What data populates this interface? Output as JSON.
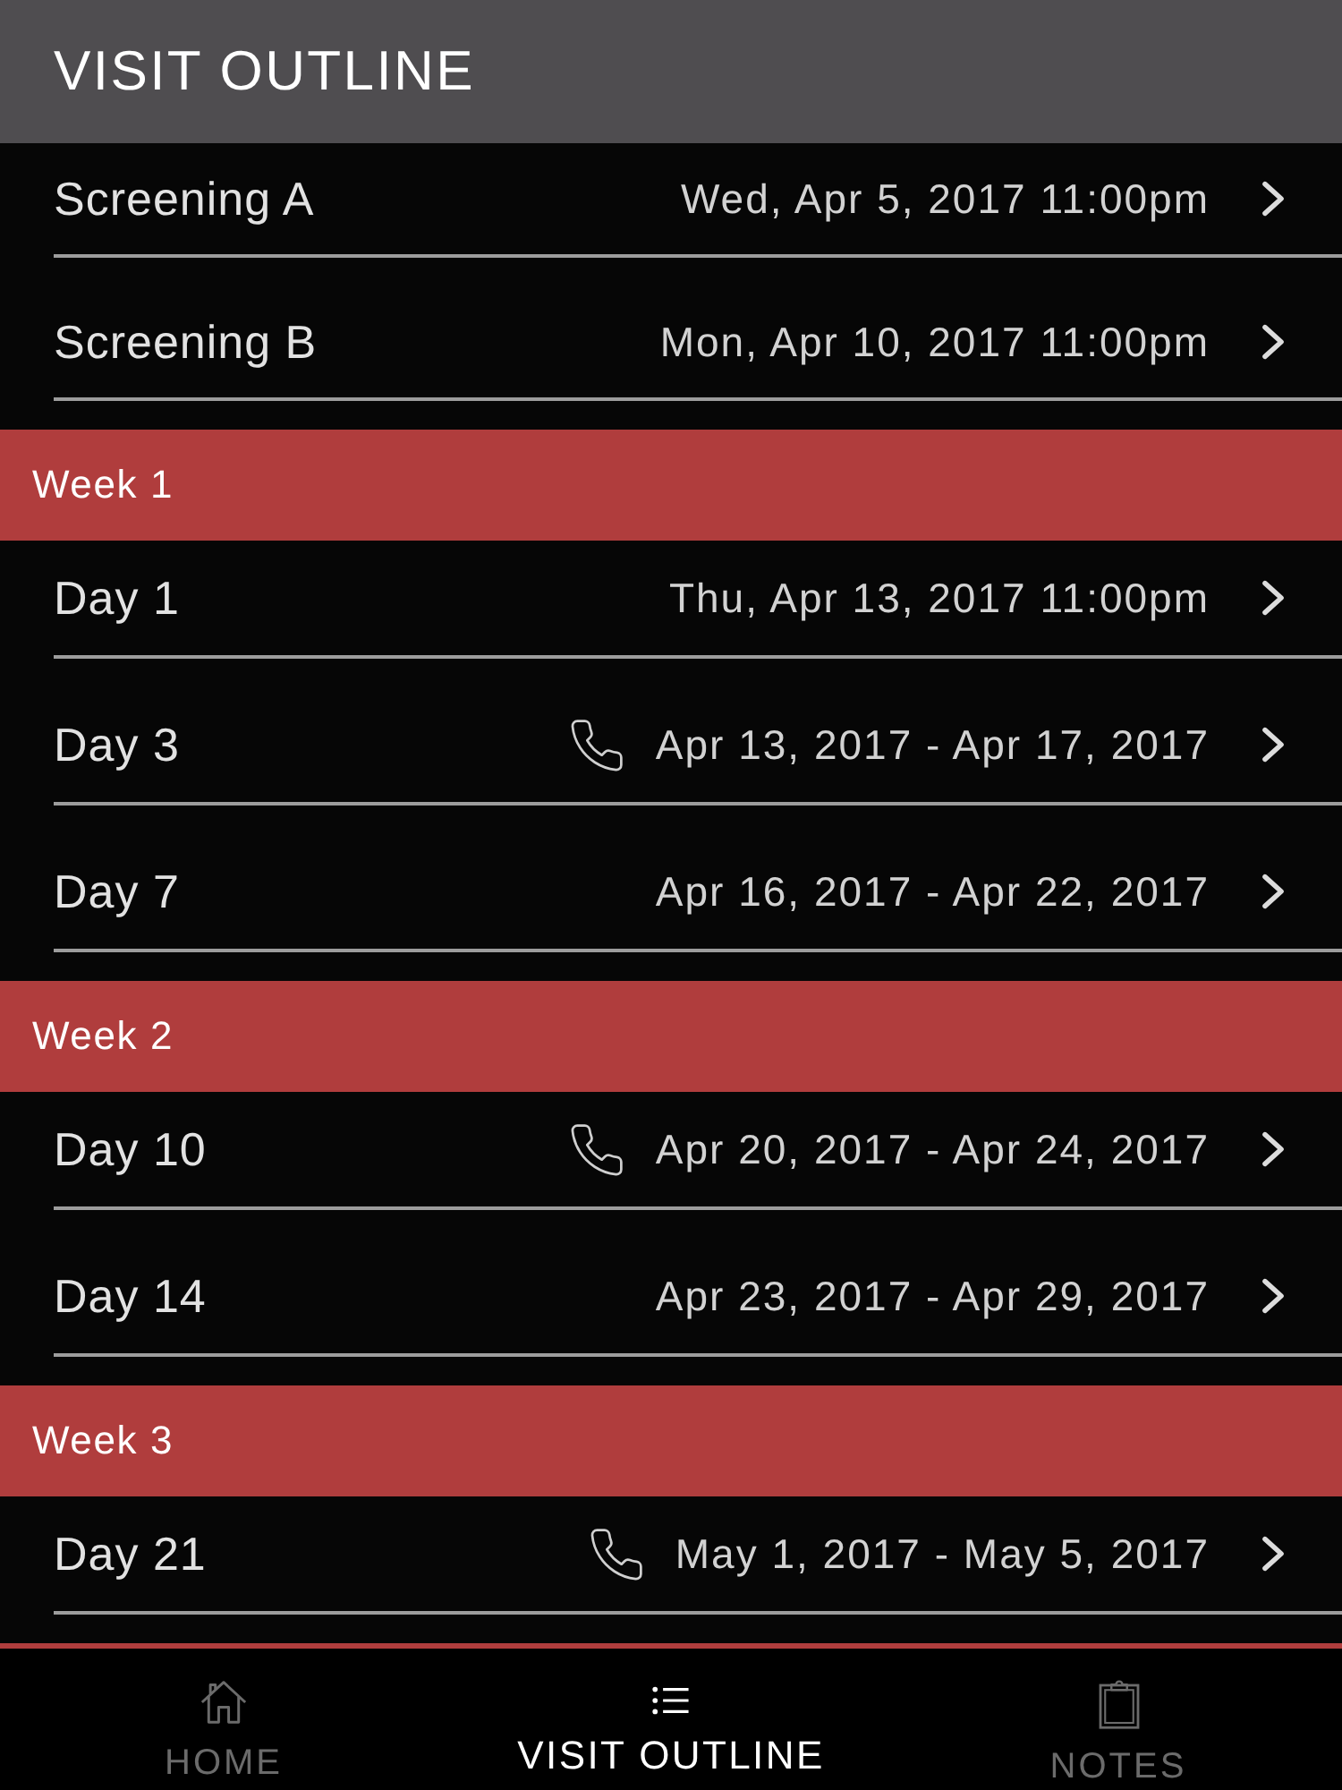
{
  "header": {
    "title": "VISIT OUTLINE"
  },
  "sections": [
    {
      "items": [
        {
          "label": "Screening A",
          "date": "Wed, Apr 5, 2017 11:00pm",
          "phone_call": false
        },
        {
          "label": "Screening B",
          "date": "Mon, Apr 10, 2017 11:00pm",
          "phone_call": false
        }
      ]
    },
    {
      "title": "Week 1",
      "items": [
        {
          "label": "Day 1",
          "date": "Thu, Apr 13, 2017 11:00pm",
          "phone_call": false
        },
        {
          "label": "Day 3",
          "date": "Apr 13, 2017 - Apr 17, 2017",
          "phone_call": true
        },
        {
          "label": "Day 7",
          "date": "Apr 16, 2017 - Apr 22, 2017",
          "phone_call": false
        }
      ]
    },
    {
      "title": "Week 2",
      "items": [
        {
          "label": "Day 10",
          "date": "Apr 20, 2017 - Apr 24, 2017",
          "phone_call": true
        },
        {
          "label": "Day 14",
          "date": "Apr 23, 2017 - Apr 29, 2017",
          "phone_call": false
        }
      ]
    },
    {
      "title": "Week 3",
      "items": [
        {
          "label": "Day 21",
          "date": "May 1, 2017 - May 5, 2017",
          "phone_call": true
        }
      ]
    }
  ],
  "tab_bar": {
    "tabs": [
      {
        "label": "HOME",
        "kind": "home",
        "selected": false
      },
      {
        "label": "VISIT OUTLINE",
        "kind": "list",
        "selected": true
      },
      {
        "label": "NOTES",
        "kind": "clipboard",
        "selected": false
      }
    ]
  }
}
